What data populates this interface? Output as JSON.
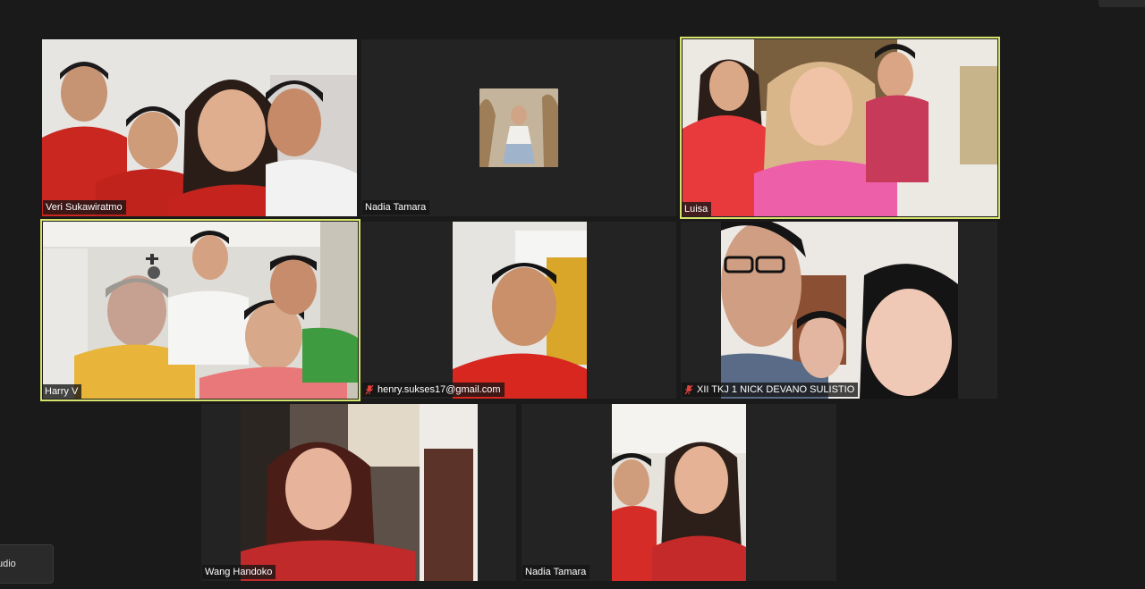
{
  "meeting": {
    "view_button_label": "",
    "audio_button_label": "udio"
  },
  "participants": [
    {
      "name": "Veri Sukawiratmo",
      "muted": false,
      "active": false
    },
    {
      "name": "Nadia Tamara",
      "muted": false,
      "active": false,
      "video_off": true
    },
    {
      "name": "Luisa",
      "muted": false,
      "active": true
    },
    {
      "name": "Harry V",
      "muted": false,
      "active": true
    },
    {
      "name": "henry.sukses17@gmail.com",
      "muted": true,
      "active": false
    },
    {
      "name": "XII TKJ 1 NICK DEVANO SULISTIO",
      "muted": true,
      "active": false
    },
    {
      "name": "Wang Handoko",
      "muted": false,
      "active": false
    },
    {
      "name": "Nadia Tamara",
      "muted": false,
      "active": false
    }
  ],
  "colors": {
    "background": "#1a1a1a",
    "tile": "#232323",
    "active_border": "#d6e36a",
    "muted_icon": "#e0413a"
  },
  "icons": {
    "muted": "mic-muted-icon"
  }
}
